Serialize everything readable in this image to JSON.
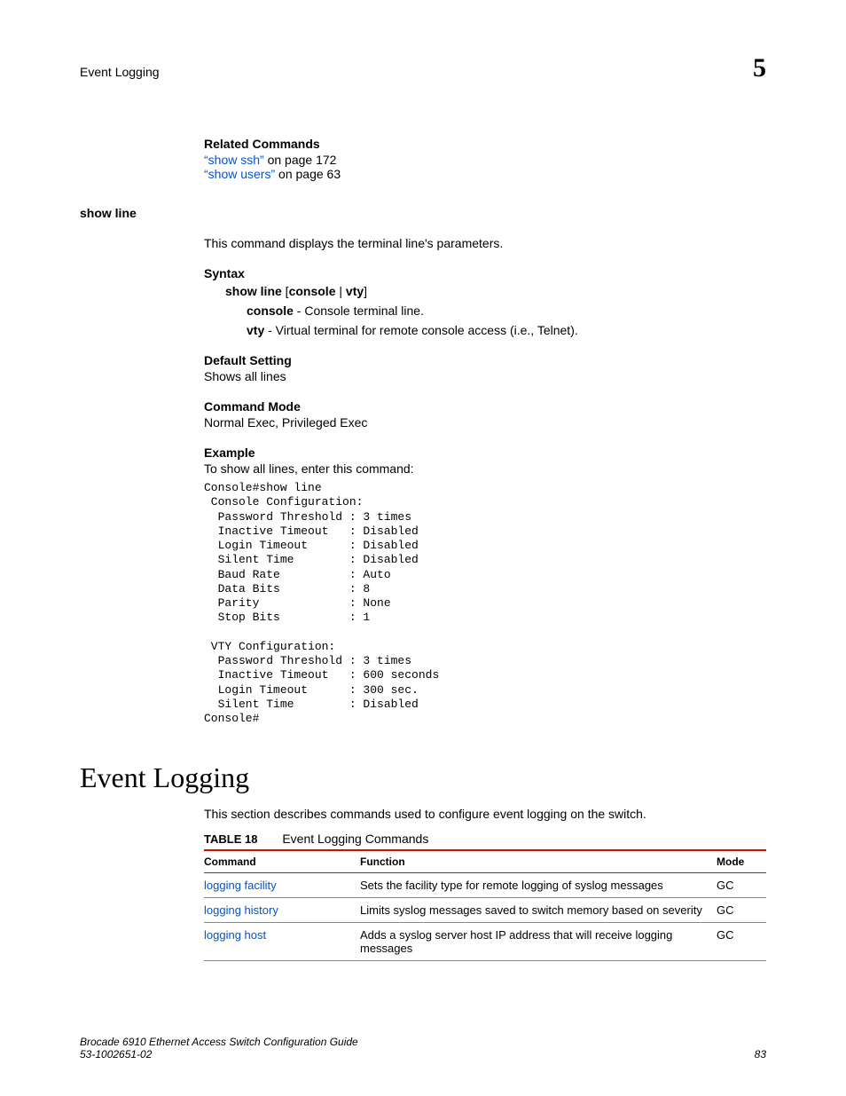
{
  "header": {
    "title": "Event Logging",
    "chapter": "5"
  },
  "related": {
    "heading": "Related Commands",
    "link1_text": "“show ssh”",
    "link1_tail": " on page 172",
    "link2_text": "“show users”",
    "link2_tail": " on page 63"
  },
  "cmd": {
    "name": "show line",
    "desc": "This command displays the terminal line's parameters.",
    "syntax_heading": "Syntax",
    "syntax_cmd": "show line",
    "syntax_open": " [",
    "syntax_opt1": "console",
    "syntax_pipe": " | ",
    "syntax_opt2": "vty",
    "syntax_close": "]",
    "opt_console_bold": "console",
    "opt_console_desc": " - Console terminal line.",
    "opt_vty_bold": "vty",
    "opt_vty_desc": " - Virtual terminal for remote console access (i.e., Telnet).",
    "default_heading": "Default Setting",
    "default_text": "Shows all lines",
    "mode_heading": "Command Mode",
    "mode_text": "Normal Exec, Privileged Exec",
    "example_heading": "Example",
    "example_intro": "To show all lines, enter this command:",
    "example_output": "Console#show line\n Console Configuration:\n  Password Threshold : 3 times\n  Inactive Timeout   : Disabled\n  Login Timeout      : Disabled\n  Silent Time        : Disabled\n  Baud Rate          : Auto\n  Data Bits          : 8\n  Parity             : None\n  Stop Bits          : 1\n\n VTY Configuration:\n  Password Threshold : 3 times\n  Inactive Timeout   : 600 seconds\n  Login Timeout      : 300 sec.\n  Silent Time        : Disabled\nConsole#"
  },
  "section": {
    "title": "Event Logging",
    "intro": "This section describes commands used to configure event logging on the switch.",
    "table_label": "TABLE 18",
    "table_caption": "Event Logging Commands",
    "th_command": "Command",
    "th_function": "Function",
    "th_mode": "Mode",
    "rows": [
      {
        "cmd": "logging facility",
        "func": "Sets the facility type for remote logging of syslog messages",
        "mode": "GC"
      },
      {
        "cmd": "logging history",
        "func": "Limits syslog messages saved to switch memory based on severity",
        "mode": "GC"
      },
      {
        "cmd": "logging host",
        "func": "Adds a syslog server host IP address that will receive logging messages",
        "mode": "GC"
      }
    ]
  },
  "footer": {
    "line1": "Brocade 6910 Ethernet Access Switch Configuration Guide",
    "line2": "53-1002651-02",
    "page": "83"
  }
}
